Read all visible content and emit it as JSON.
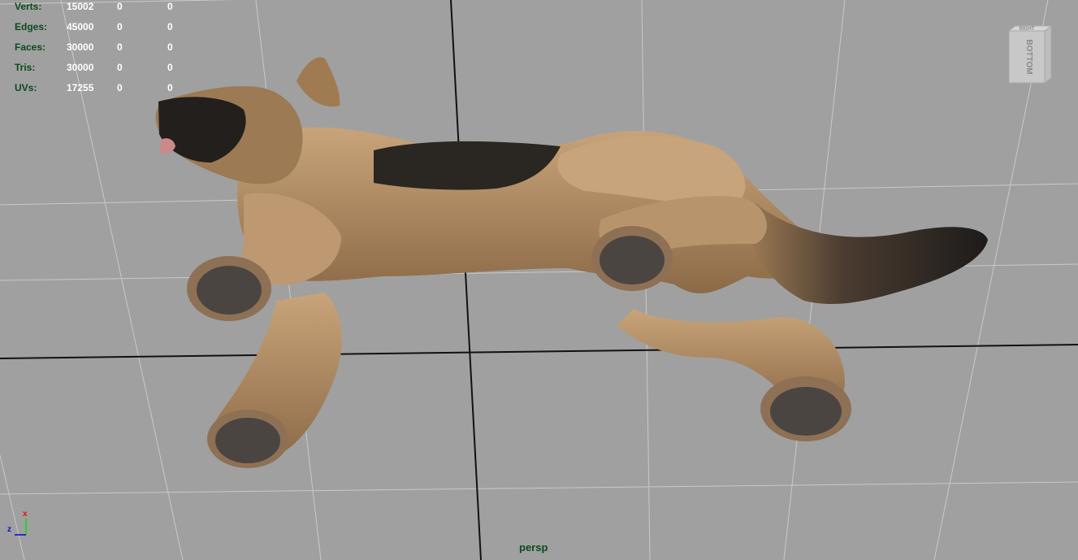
{
  "hud": {
    "rows": [
      {
        "label": "Verts:",
        "v1": "15002",
        "v2": "0",
        "v3": "0"
      },
      {
        "label": "Edges:",
        "v1": "45000",
        "v2": "0",
        "v3": "0"
      },
      {
        "label": "Faces:",
        "v1": "30000",
        "v2": "0",
        "v3": "0"
      },
      {
        "label": "Tris:",
        "v1": "30000",
        "v2": "0",
        "v3": "0"
      },
      {
        "label": "UVs:",
        "v1": "17255",
        "v2": "0",
        "v3": "0"
      }
    ]
  },
  "viewcube": {
    "top_face": "RIGHT",
    "front_face": "BOTTOM"
  },
  "camera_label": "persp",
  "axis": {
    "x": "x",
    "z": "z"
  },
  "colors": {
    "background": "#a0a0a0",
    "hud_label": "#0b4a1c",
    "hud_value": "#ffffff",
    "fur": "#b08a5e",
    "saddle": "#2a2622"
  }
}
